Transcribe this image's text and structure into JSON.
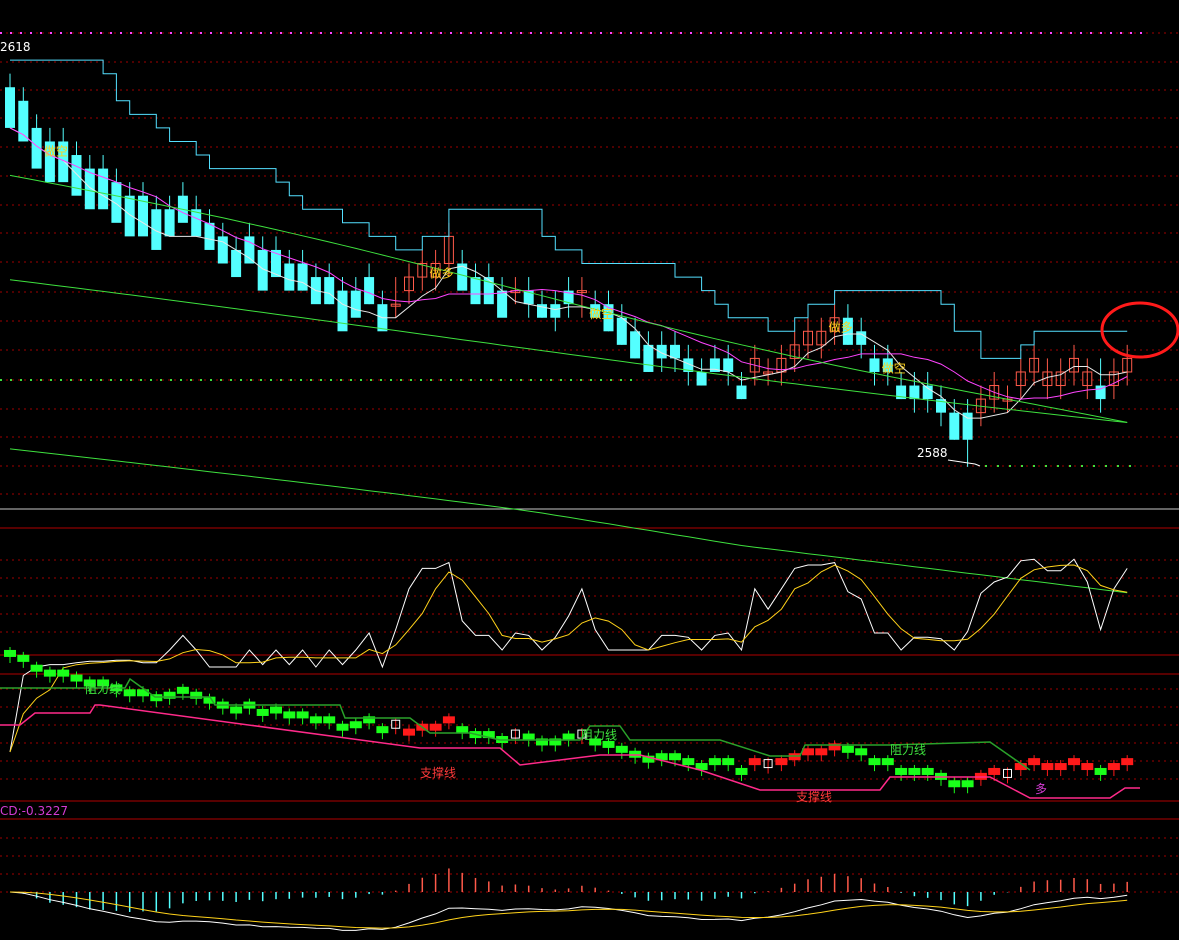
{
  "colors": {
    "background": "#000000",
    "up": "#ff5a4a",
    "down": "#54ffff",
    "ma_white": "#e8e8e8",
    "ma_magenta": "#ff44ff",
    "ma_green": "#3ee03e",
    "channel_cyan": "#54e0ff",
    "signal_yellow": "#ffd21a",
    "grid_red": "#a00000",
    "support_line": "#ff2a8a",
    "resistance_line": "#2aa12a",
    "highlight_circle": "#ff1a1a"
  },
  "chart_data": [
    {
      "type": "candlestick",
      "panel": "main",
      "price_labels": {
        "high": "2618",
        "low": "2588"
      },
      "signals": [
        {
          "text": "做空",
          "index": 3
        },
        {
          "text": "做多",
          "index": 32
        },
        {
          "text": "做空",
          "index": 44
        },
        {
          "text": "做多",
          "index": 62
        },
        {
          "text": "做空",
          "index": 66
        }
      ],
      "candles": [
        [
          2616,
          2617,
          2615,
          2613
        ],
        [
          2615,
          2616,
          2613,
          2612
        ],
        [
          2613,
          2614,
          2611,
          2610
        ],
        [
          2612,
          2613,
          2610,
          2609
        ],
        [
          2612,
          2613,
          2610,
          2609
        ],
        [
          2611,
          2612,
          2609,
          2608
        ],
        [
          2610,
          2611,
          2608,
          2607
        ],
        [
          2610,
          2611,
          2608,
          2607
        ],
        [
          2609,
          2610,
          2607,
          2606
        ],
        [
          2608,
          2609,
          2606,
          2605
        ],
        [
          2608,
          2609,
          2606,
          2605
        ],
        [
          2607,
          2608,
          2605,
          2604
        ],
        [
          2607,
          2608,
          2606,
          2605
        ],
        [
          2608,
          2609,
          2607,
          2606
        ],
        [
          2607,
          2608,
          2606,
          2605
        ],
        [
          2606,
          2607,
          2605,
          2604
        ],
        [
          2605,
          2606,
          2604,
          2603
        ],
        [
          2604,
          2605,
          2603,
          2602
        ],
        [
          2605,
          2606,
          2603,
          2603
        ],
        [
          2604,
          2605,
          2602,
          2601
        ],
        [
          2604,
          2605,
          2603,
          2602
        ],
        [
          2603,
          2604,
          2602,
          2601
        ],
        [
          2603,
          2604,
          2601,
          2601
        ],
        [
          2602,
          2603,
          2601,
          2600
        ],
        [
          2602,
          2603,
          2600,
          2600
        ],
        [
          2601,
          2602,
          2599,
          2598
        ],
        [
          2601,
          2602,
          2600,
          2599
        ],
        [
          2602,
          2603,
          2600,
          2600
        ],
        [
          2600,
          2601,
          2599,
          2598
        ],
        [
          2600,
          2602,
          2599,
          2600
        ],
        [
          2601,
          2603,
          2600,
          2602
        ],
        [
          2602,
          2604,
          2601,
          2603
        ],
        [
          2602,
          2604,
          2601,
          2603
        ],
        [
          2603,
          2606,
          2602,
          2605
        ],
        [
          2603,
          2604,
          2602,
          2601
        ],
        [
          2602,
          2603,
          2601,
          2600
        ],
        [
          2602,
          2603,
          2601,
          2600
        ],
        [
          2601,
          2602,
          2600,
          2599
        ],
        [
          2601,
          2602,
          2600,
          2601
        ],
        [
          2601,
          2602,
          2599,
          2600
        ],
        [
          2600,
          2601,
          2599,
          2599
        ],
        [
          2600,
          2601,
          2598,
          2599
        ],
        [
          2601,
          2602,
          2599,
          2600
        ],
        [
          2601,
          2602,
          2599,
          2601
        ],
        [
          2600,
          2601,
          2599,
          2599
        ],
        [
          2600,
          2601,
          2598,
          2598
        ],
        [
          2599,
          2600,
          2597,
          2597
        ],
        [
          2598,
          2599,
          2596,
          2596
        ],
        [
          2597,
          2598,
          2595,
          2595
        ],
        [
          2597,
          2598,
          2595,
          2596
        ],
        [
          2597,
          2598,
          2595,
          2596
        ],
        [
          2596,
          2597,
          2594,
          2595
        ],
        [
          2595,
          2596,
          2594,
          2594
        ],
        [
          2596,
          2597,
          2595,
          2595
        ],
        [
          2596,
          2597,
          2594,
          2595
        ],
        [
          2594,
          2595,
          2593,
          2593
        ],
        [
          2595,
          2597,
          2594,
          2596
        ],
        [
          2595,
          2596,
          2594,
          2595
        ],
        [
          2595,
          2597,
          2594,
          2596
        ],
        [
          2596,
          2598,
          2595,
          2597
        ],
        [
          2597,
          2599,
          2596,
          2598
        ],
        [
          2597,
          2599,
          2596,
          2598
        ],
        [
          2598,
          2600,
          2597,
          2599
        ],
        [
          2599,
          2600,
          2597,
          2597
        ],
        [
          2598,
          2599,
          2596,
          2597
        ],
        [
          2596,
          2597,
          2594,
          2595
        ],
        [
          2596,
          2597,
          2594,
          2595
        ],
        [
          2594,
          2595,
          2593,
          2593
        ],
        [
          2594,
          2595,
          2592,
          2593
        ],
        [
          2594,
          2595,
          2592,
          2593
        ],
        [
          2593,
          2594,
          2591,
          2592
        ],
        [
          2592,
          2593,
          2590,
          2590
        ],
        [
          2592,
          2593,
          2588,
          2590
        ],
        [
          2592,
          2594,
          2591,
          2593
        ],
        [
          2593,
          2595,
          2592,
          2594
        ],
        [
          2593,
          2594,
          2592,
          2593
        ],
        [
          2594,
          2596,
          2593,
          2595
        ],
        [
          2595,
          2597,
          2594,
          2596
        ],
        [
          2594,
          2596,
          2593,
          2595
        ],
        [
          2594,
          2596,
          2593,
          2595
        ],
        [
          2595,
          2597,
          2594,
          2596
        ],
        [
          2594,
          2596,
          2593,
          2595
        ],
        [
          2594,
          2596,
          2592,
          2593
        ],
        [
          2594,
          2596,
          2593,
          2595
        ],
        [
          2595,
          2597,
          2594,
          2596
        ]
      ]
    },
    {
      "type": "line",
      "panel": "oscillator"
    },
    {
      "type": "band-candles",
      "panel": "support-resistance",
      "annotations": [
        "阻力线",
        "阻力线",
        "阻力线",
        "支撑线",
        "支撑线",
        "多"
      ]
    },
    {
      "type": "macd",
      "panel": "macd",
      "label": "CD:-0.3227"
    }
  ]
}
